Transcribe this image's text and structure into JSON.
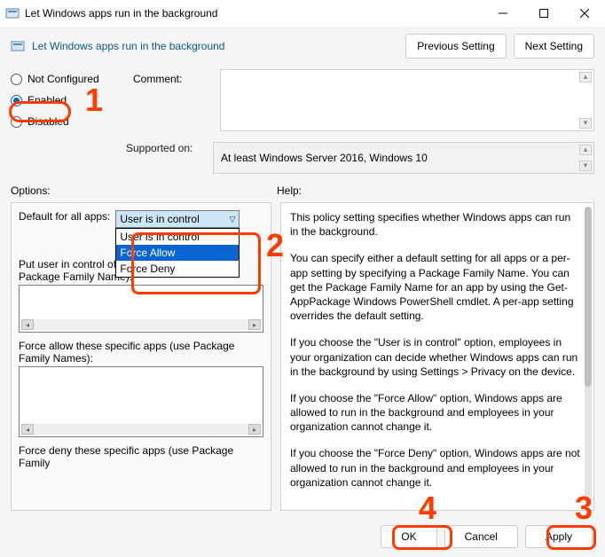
{
  "window": {
    "title": "Let Windows apps run in the background"
  },
  "header": {
    "subtitle": "Let Windows apps run in the background",
    "prev": "Previous Setting",
    "next": "Next Setting"
  },
  "radios": {
    "not_configured": "Not Configured",
    "enabled": "Enabled",
    "disabled": "Disabled"
  },
  "labels": {
    "comment": "Comment:",
    "supported": "Supported on:",
    "options": "Options:",
    "help": "Help:"
  },
  "supported_text": "At least Windows Server 2016, Windows 10",
  "options_panel": {
    "default_label": "Default for all apps:",
    "select_value": "User is in control",
    "choices": [
      "User is in control",
      "Force Allow",
      "Force Deny"
    ],
    "selected_index": 1,
    "put_user_label": "Put user in control of these specific apps (use Package Family Name):",
    "force_allow_label": "Force allow these specific apps (use Package Family Names):",
    "force_deny_label": "Force deny these specific apps (use Package Family"
  },
  "help_text": {
    "p1": "This policy setting specifies whether Windows apps can run in the background.",
    "p2": "You can specify either a default setting for all apps or a per-app setting by specifying a Package Family Name. You can get the Package Family Name for an app by using the Get-AppPackage Windows PowerShell cmdlet. A per-app setting overrides the default setting.",
    "p3": "If you choose the \"User is in control\" option, employees in your organization can decide whether Windows apps can run in the background by using Settings > Privacy on the device.",
    "p4": "If you choose the \"Force Allow\" option, Windows apps are allowed to run in the background and employees in your organization cannot change it.",
    "p5": "If you choose the \"Force Deny\" option, Windows apps are not allowed to run in the background and employees in your organization cannot change it."
  },
  "buttons": {
    "ok": "OK",
    "cancel": "Cancel",
    "apply": "Apply"
  },
  "annotations": {
    "a1": "1",
    "a2": "2",
    "a3": "3",
    "a4": "4"
  }
}
